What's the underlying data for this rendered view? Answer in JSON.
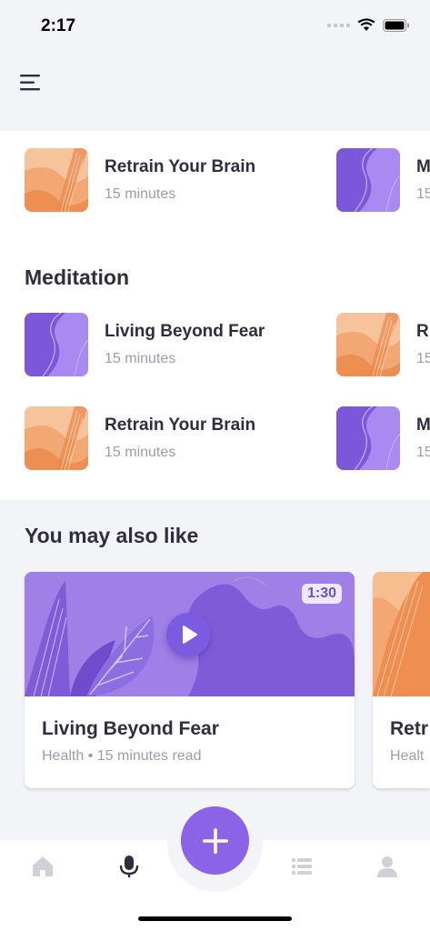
{
  "status": {
    "time": "2:17"
  },
  "rows": [
    {
      "title": "Retrain Your Brain",
      "subtitle": "15 minutes",
      "art": "orange"
    },
    {
      "title": "M",
      "subtitle": "15",
      "art": "purple"
    },
    {
      "title": "Living Beyond Fear",
      "subtitle": "15 minutes",
      "art": "purple"
    },
    {
      "title": "R",
      "subtitle": "15",
      "art": "orange"
    },
    {
      "title": "Retrain Your Brain",
      "subtitle": "15 minutes",
      "art": "orange"
    },
    {
      "title": "M",
      "subtitle": "15",
      "art": "purple"
    }
  ],
  "sections": {
    "meditation": "Meditation",
    "also_like": "You may also like"
  },
  "cards": [
    {
      "title": "Living Beyond Fear",
      "subtitle": "Health • 15 minutes read",
      "duration": "1:30"
    },
    {
      "title": "Retr",
      "subtitle": "Healt"
    }
  ],
  "icons": {
    "menu": "menu-icon",
    "play": "play-icon",
    "add": "plus-icon",
    "tabs": [
      "home-icon",
      "microphone-icon",
      "list-icon",
      "profile-icon"
    ]
  },
  "colors": {
    "accent": "#8a63e6",
    "orange": "#f0955a",
    "purple": "#8a63e6",
    "text": "#2f2e41",
    "muted": "#9d9bb0"
  }
}
